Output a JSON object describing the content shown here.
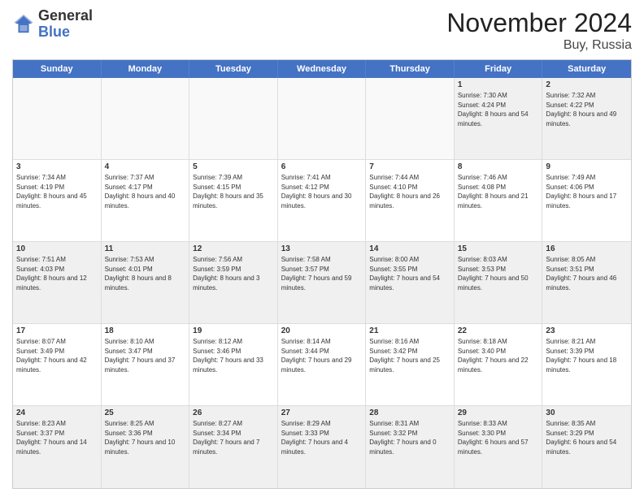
{
  "logo": {
    "general": "General",
    "blue": "Blue"
  },
  "header": {
    "title": "November 2024",
    "location": "Buy, Russia"
  },
  "weekdays": [
    "Sunday",
    "Monday",
    "Tuesday",
    "Wednesday",
    "Thursday",
    "Friday",
    "Saturday"
  ],
  "weeks": [
    [
      {
        "day": "",
        "empty": true
      },
      {
        "day": "",
        "empty": true
      },
      {
        "day": "",
        "empty": true
      },
      {
        "day": "",
        "empty": true
      },
      {
        "day": "",
        "empty": true
      },
      {
        "day": "1",
        "sunrise": "Sunrise: 7:30 AM",
        "sunset": "Sunset: 4:24 PM",
        "daylight": "Daylight: 8 hours and 54 minutes."
      },
      {
        "day": "2",
        "sunrise": "Sunrise: 7:32 AM",
        "sunset": "Sunset: 4:22 PM",
        "daylight": "Daylight: 8 hours and 49 minutes."
      }
    ],
    [
      {
        "day": "3",
        "sunrise": "Sunrise: 7:34 AM",
        "sunset": "Sunset: 4:19 PM",
        "daylight": "Daylight: 8 hours and 45 minutes."
      },
      {
        "day": "4",
        "sunrise": "Sunrise: 7:37 AM",
        "sunset": "Sunset: 4:17 PM",
        "daylight": "Daylight: 8 hours and 40 minutes."
      },
      {
        "day": "5",
        "sunrise": "Sunrise: 7:39 AM",
        "sunset": "Sunset: 4:15 PM",
        "daylight": "Daylight: 8 hours and 35 minutes."
      },
      {
        "day": "6",
        "sunrise": "Sunrise: 7:41 AM",
        "sunset": "Sunset: 4:12 PM",
        "daylight": "Daylight: 8 hours and 30 minutes."
      },
      {
        "day": "7",
        "sunrise": "Sunrise: 7:44 AM",
        "sunset": "Sunset: 4:10 PM",
        "daylight": "Daylight: 8 hours and 26 minutes."
      },
      {
        "day": "8",
        "sunrise": "Sunrise: 7:46 AM",
        "sunset": "Sunset: 4:08 PM",
        "daylight": "Daylight: 8 hours and 21 minutes."
      },
      {
        "day": "9",
        "sunrise": "Sunrise: 7:49 AM",
        "sunset": "Sunset: 4:06 PM",
        "daylight": "Daylight: 8 hours and 17 minutes."
      }
    ],
    [
      {
        "day": "10",
        "sunrise": "Sunrise: 7:51 AM",
        "sunset": "Sunset: 4:03 PM",
        "daylight": "Daylight: 8 hours and 12 minutes."
      },
      {
        "day": "11",
        "sunrise": "Sunrise: 7:53 AM",
        "sunset": "Sunset: 4:01 PM",
        "daylight": "Daylight: 8 hours and 8 minutes."
      },
      {
        "day": "12",
        "sunrise": "Sunrise: 7:56 AM",
        "sunset": "Sunset: 3:59 PM",
        "daylight": "Daylight: 8 hours and 3 minutes."
      },
      {
        "day": "13",
        "sunrise": "Sunrise: 7:58 AM",
        "sunset": "Sunset: 3:57 PM",
        "daylight": "Daylight: 7 hours and 59 minutes."
      },
      {
        "day": "14",
        "sunrise": "Sunrise: 8:00 AM",
        "sunset": "Sunset: 3:55 PM",
        "daylight": "Daylight: 7 hours and 54 minutes."
      },
      {
        "day": "15",
        "sunrise": "Sunrise: 8:03 AM",
        "sunset": "Sunset: 3:53 PM",
        "daylight": "Daylight: 7 hours and 50 minutes."
      },
      {
        "day": "16",
        "sunrise": "Sunrise: 8:05 AM",
        "sunset": "Sunset: 3:51 PM",
        "daylight": "Daylight: 7 hours and 46 minutes."
      }
    ],
    [
      {
        "day": "17",
        "sunrise": "Sunrise: 8:07 AM",
        "sunset": "Sunset: 3:49 PM",
        "daylight": "Daylight: 7 hours and 42 minutes."
      },
      {
        "day": "18",
        "sunrise": "Sunrise: 8:10 AM",
        "sunset": "Sunset: 3:47 PM",
        "daylight": "Daylight: 7 hours and 37 minutes."
      },
      {
        "day": "19",
        "sunrise": "Sunrise: 8:12 AM",
        "sunset": "Sunset: 3:46 PM",
        "daylight": "Daylight: 7 hours and 33 minutes."
      },
      {
        "day": "20",
        "sunrise": "Sunrise: 8:14 AM",
        "sunset": "Sunset: 3:44 PM",
        "daylight": "Daylight: 7 hours and 29 minutes."
      },
      {
        "day": "21",
        "sunrise": "Sunrise: 8:16 AM",
        "sunset": "Sunset: 3:42 PM",
        "daylight": "Daylight: 7 hours and 25 minutes."
      },
      {
        "day": "22",
        "sunrise": "Sunrise: 8:18 AM",
        "sunset": "Sunset: 3:40 PM",
        "daylight": "Daylight: 7 hours and 22 minutes."
      },
      {
        "day": "23",
        "sunrise": "Sunrise: 8:21 AM",
        "sunset": "Sunset: 3:39 PM",
        "daylight": "Daylight: 7 hours and 18 minutes."
      }
    ],
    [
      {
        "day": "24",
        "sunrise": "Sunrise: 8:23 AM",
        "sunset": "Sunset: 3:37 PM",
        "daylight": "Daylight: 7 hours and 14 minutes."
      },
      {
        "day": "25",
        "sunrise": "Sunrise: 8:25 AM",
        "sunset": "Sunset: 3:36 PM",
        "daylight": "Daylight: 7 hours and 10 minutes."
      },
      {
        "day": "26",
        "sunrise": "Sunrise: 8:27 AM",
        "sunset": "Sunset: 3:34 PM",
        "daylight": "Daylight: 7 hours and 7 minutes."
      },
      {
        "day": "27",
        "sunrise": "Sunrise: 8:29 AM",
        "sunset": "Sunset: 3:33 PM",
        "daylight": "Daylight: 7 hours and 4 minutes."
      },
      {
        "day": "28",
        "sunrise": "Sunrise: 8:31 AM",
        "sunset": "Sunset: 3:32 PM",
        "daylight": "Daylight: 7 hours and 0 minutes."
      },
      {
        "day": "29",
        "sunrise": "Sunrise: 8:33 AM",
        "sunset": "Sunset: 3:30 PM",
        "daylight": "Daylight: 6 hours and 57 minutes."
      },
      {
        "day": "30",
        "sunrise": "Sunrise: 8:35 AM",
        "sunset": "Sunset: 3:29 PM",
        "daylight": "Daylight: 6 hours and 54 minutes."
      }
    ]
  ]
}
